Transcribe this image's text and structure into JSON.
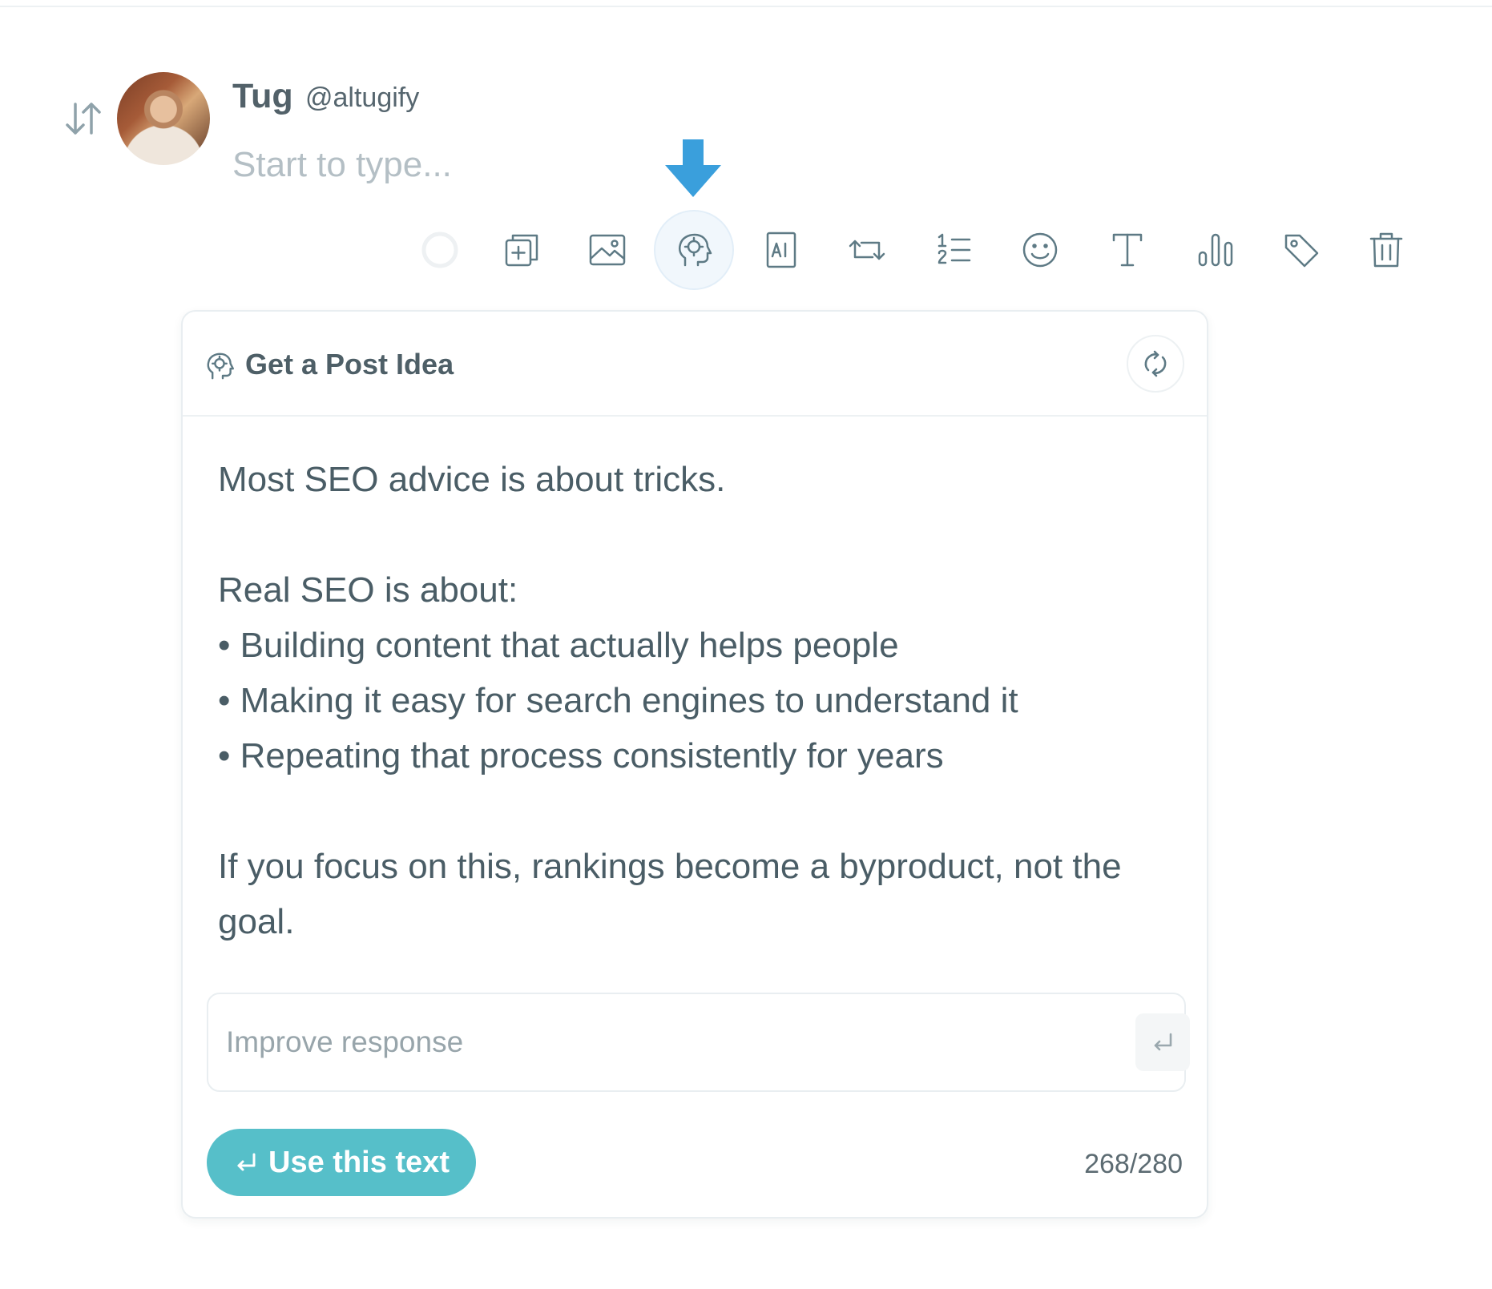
{
  "author": {
    "name": "Tug",
    "handle": "@altugify"
  },
  "composer": {
    "placeholder": "Start to type..."
  },
  "toolbar": {
    "items": [
      {
        "name": "loading-spinner-icon",
        "active": false
      },
      {
        "name": "add-post-icon",
        "active": false
      },
      {
        "name": "image-icon",
        "active": false
      },
      {
        "name": "post-idea-icon",
        "active": true
      },
      {
        "name": "ai-icon",
        "active": false
      },
      {
        "name": "retweet-icon",
        "active": false
      },
      {
        "name": "numbered-list-icon",
        "active": false
      },
      {
        "name": "emoji-icon",
        "active": false
      },
      {
        "name": "text-format-icon",
        "active": false
      },
      {
        "name": "poll-icon",
        "active": false
      },
      {
        "name": "tag-icon",
        "active": false
      },
      {
        "name": "trash-icon",
        "active": false
      }
    ]
  },
  "idea_card": {
    "title": "Get a Post Idea",
    "lines": [
      "Most SEO advice is about tricks.",
      "",
      "Real SEO is about:",
      "• Building content that actually helps people",
      "• Making it easy for search engines to understand it",
      "• Repeating that process consistently for years",
      "",
      "If you focus on this, rankings become a byproduct, not the",
      "goal."
    ],
    "improve_placeholder": "Improve response",
    "use_button_label": "Use this text",
    "char_count": "268/280"
  },
  "colors": {
    "accent": "#56bfc9",
    "arrow": "#3a9fdc",
    "icon": "#5e7a85"
  }
}
